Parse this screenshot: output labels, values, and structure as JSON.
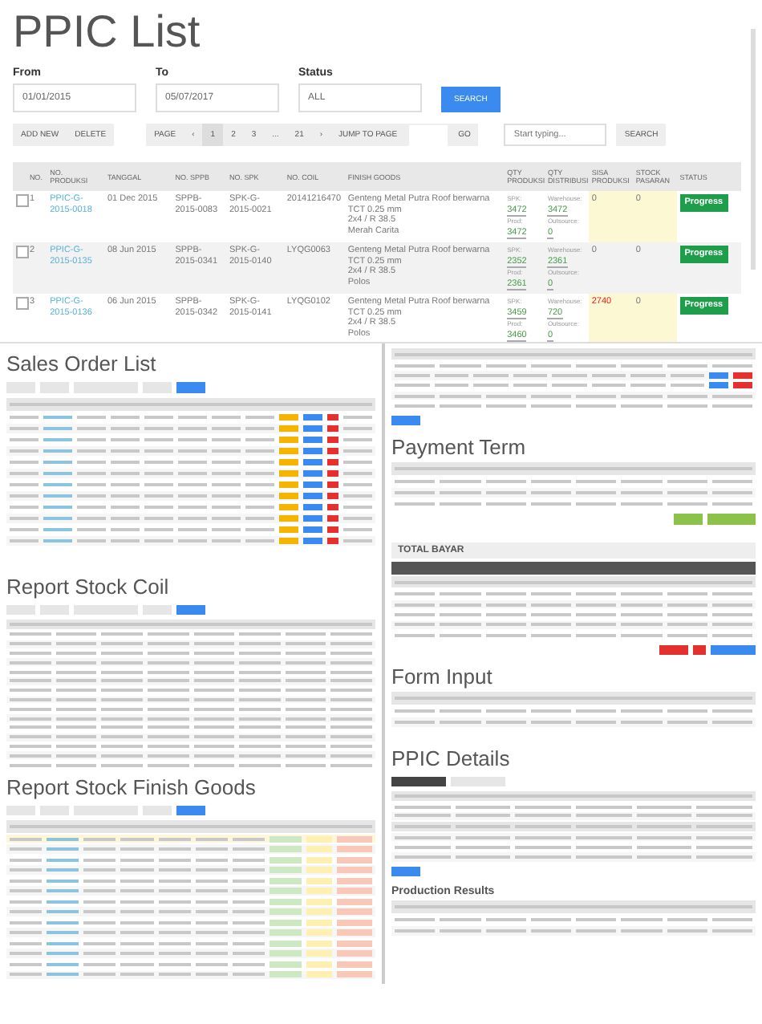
{
  "ppic_list": {
    "title": "PPIC List",
    "filters": [
      {
        "label": "From",
        "value": "01/01/2015"
      },
      {
        "label": "To",
        "value": "05/07/2017"
      },
      {
        "label": "Status",
        "value": "ALL"
      }
    ],
    "search_button": "SEARCH",
    "actions": [
      "ADD NEW",
      "DELETE"
    ],
    "pagination": {
      "label": "PAGE",
      "prev": "‹",
      "next": "›",
      "pages": [
        {
          "label": "1",
          "selected": true
        },
        {
          "label": "2",
          "selected": false
        },
        {
          "label": "3",
          "selected": false
        },
        {
          "label": "...",
          "selected": false
        },
        {
          "label": "21",
          "selected": false
        }
      ],
      "jump_label": "JUMP TO PAGE",
      "go": "GO"
    },
    "quick_search": {
      "placeholder": "Start typing...",
      "button": "SEARCH"
    },
    "columns": [
      "NO.",
      "NO. PRODUKSI",
      "TANGGAL",
      "NO. SPPB",
      "NO. SPK",
      "NO. COIL",
      "FINISH GOODS",
      "QTY PRODUKSI",
      "QTY DISTRIBUSI",
      "SISA PRODUKSI",
      "STOCK PASARAN",
      "STATUS"
    ],
    "rows": [
      {
        "checked": false,
        "selected": false,
        "no": "1",
        "no_produksi": "PPIC-G-2015-0018",
        "tanggal": "01 Dec 2015",
        "no_sppb": "SPPB-2015-0083",
        "no_spk": "SPK-G-2015-0021",
        "no_coil": "20141216470",
        "finish_goods": [
          "Genteng Metal Putra Roof berwarna",
          "TCT 0.25 mm",
          "2x4 / R 38.5",
          "Merah Carita"
        ],
        "spk_label": "SPK:",
        "spk": "3472",
        "prod_label": "Prod:",
        "prod": "3472",
        "warehouse_label": "Warehouse:",
        "warehouse": "3472",
        "outsource_label": "Outsource:",
        "outsource": "0",
        "sisa_produksi": "0",
        "sisa_alert": false,
        "stock_pasaran": "0",
        "status": "Progress"
      },
      {
        "checked": false,
        "selected": true,
        "no": "2",
        "no_produksi": "PPIC-G-2015-0135",
        "tanggal": "08 Jun 2015",
        "no_sppb": "SPPB-2015-0341",
        "no_spk": "SPK-G-2015-0140",
        "no_coil": "LYQG0063",
        "finish_goods": [
          "Genteng Metal Putra Roof berwarna",
          "TCT 0.25 mm",
          "2x4 / R 38.5",
          "Polos"
        ],
        "spk_label": "SPK:",
        "spk": "2352",
        "prod_label": "Prod:",
        "prod": "2361",
        "warehouse_label": "Warehouse:",
        "warehouse": "2361",
        "outsource_label": "Outsource:",
        "outsource": "0",
        "sisa_produksi": "0",
        "sisa_alert": false,
        "stock_pasaran": "0",
        "status": "Progress"
      },
      {
        "checked": false,
        "selected": false,
        "no": "3",
        "no_produksi": "PPIC-G-2015-0136",
        "tanggal": "06 Jun 2015",
        "no_sppb": "SPPB-2015-0342",
        "no_spk": "SPK-G-2015-0141",
        "no_coil": "LYQG0102",
        "finish_goods": [
          "Genteng Metal Putra Roof berwarna",
          "TCT 0.25 mm",
          "2x4 / R 38.5",
          "Polos"
        ],
        "spk_label": "SPK:",
        "spk": "3459",
        "prod_label": "Prod:",
        "prod": "3460",
        "warehouse_label": "Warehouse:",
        "warehouse": "720",
        "outsource_label": "Outsource:",
        "outsource": "0",
        "sisa_produksi": "2740",
        "sisa_alert": true,
        "stock_pasaran": "0",
        "status": "Progress"
      }
    ]
  },
  "left_panels": [
    {
      "kind": "sales",
      "title": "Sales Order List"
    },
    {
      "kind": "coil",
      "title": "Report Stock Coil"
    },
    {
      "kind": "goods",
      "title": "Report Stock Finish Goods"
    }
  ],
  "right_panels": [
    {
      "kind": "order"
    },
    {
      "kind": "payment",
      "title": "Payment Term",
      "total_label": "TOTAL BAYAR"
    },
    {
      "kind": "info"
    },
    {
      "kind": "form",
      "title": "Form Input"
    },
    {
      "kind": "details",
      "title": "PPIC Details",
      "subtitle": "Production Results"
    }
  ]
}
